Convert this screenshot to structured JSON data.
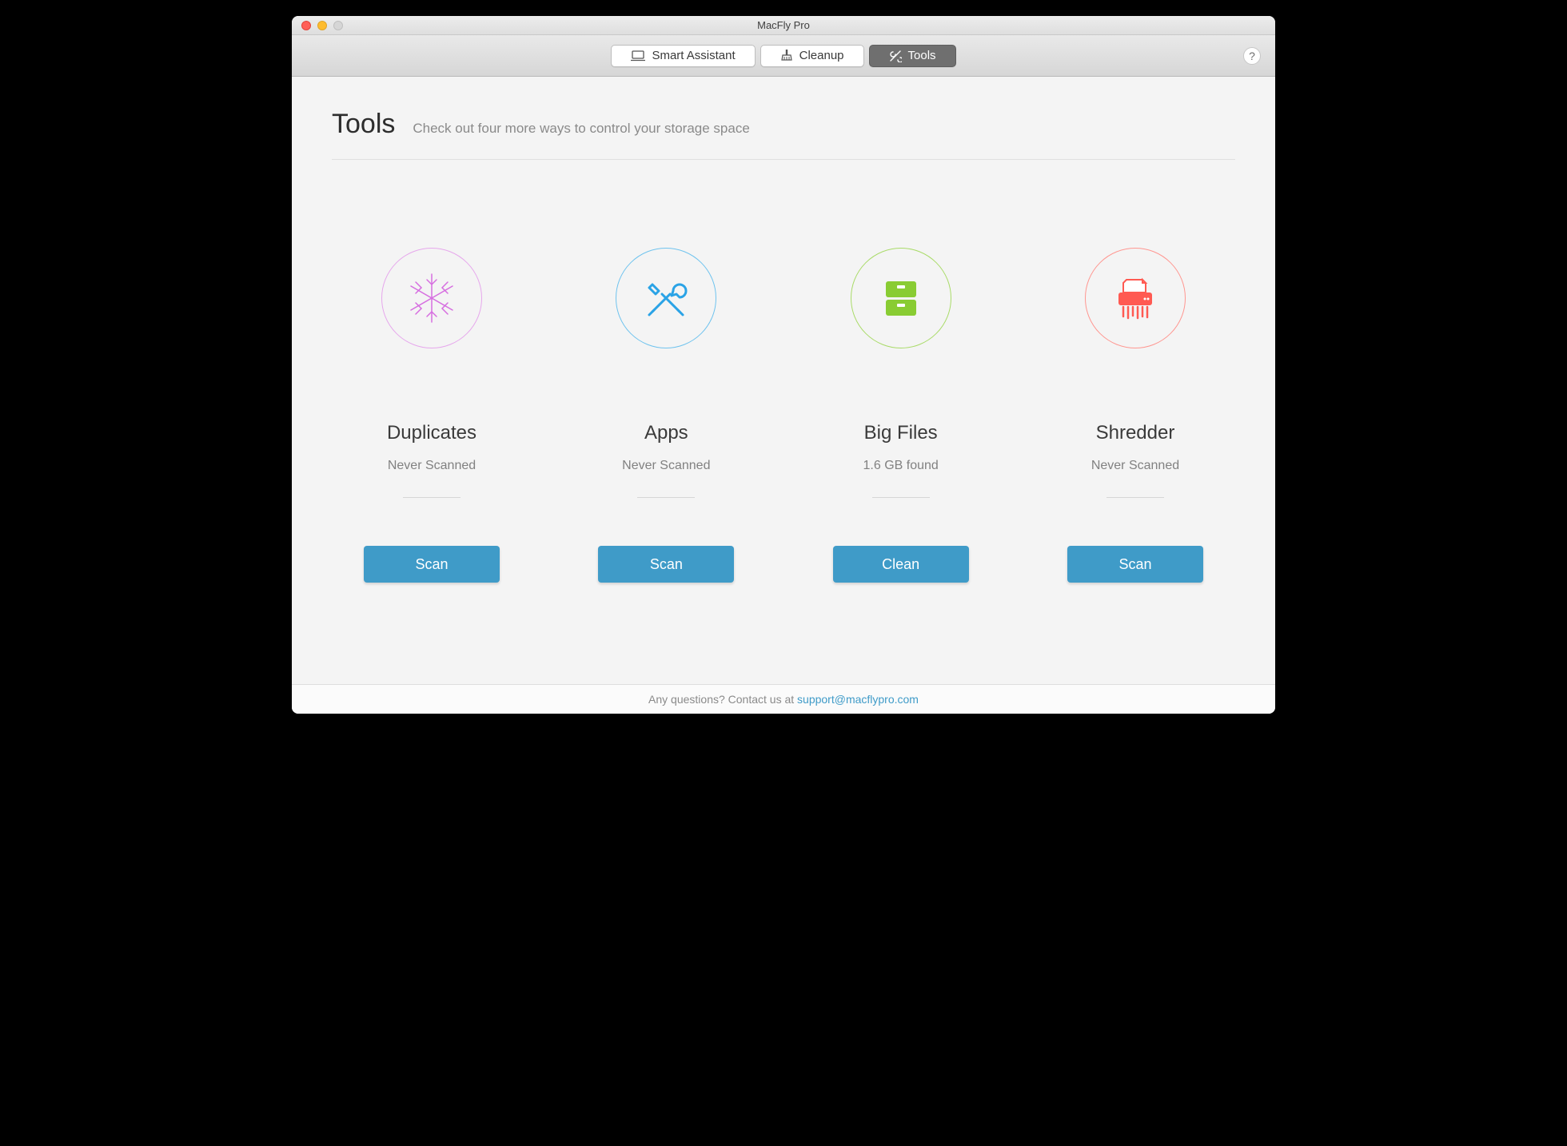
{
  "window": {
    "title": "MacFly Pro"
  },
  "toolbar": {
    "tabs": [
      {
        "label": "Smart Assistant",
        "icon": "laptop-icon",
        "active": false
      },
      {
        "label": "Cleanup",
        "icon": "broom-icon",
        "active": false
      },
      {
        "label": "Tools",
        "icon": "wrench-icon",
        "active": true
      }
    ],
    "help_tooltip": "?"
  },
  "page": {
    "title": "Tools",
    "subtitle": "Check out four more ways to control your storage space"
  },
  "cards": [
    {
      "title": "Duplicates",
      "status": "Never Scanned",
      "button": "Scan",
      "icon": "snowflake-icon",
      "color": "#d66ee0"
    },
    {
      "title": "Apps",
      "status": "Never Scanned",
      "button": "Scan",
      "icon": "tools-icon",
      "color": "#2aa3e6"
    },
    {
      "title": "Big Files",
      "status": "1.6 GB found",
      "button": "Clean",
      "icon": "drawer-icon",
      "color": "#89cc33"
    },
    {
      "title": "Shredder",
      "status": "Never Scanned",
      "button": "Scan",
      "icon": "shredder-icon",
      "color": "#ff5a52"
    }
  ],
  "footer": {
    "text": "Any questions? Contact us at ",
    "link_label": "support@macflypro.com"
  }
}
